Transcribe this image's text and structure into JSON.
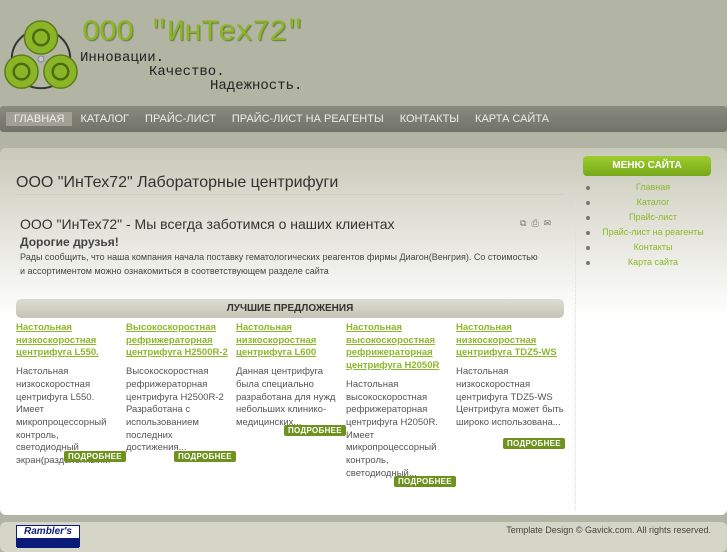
{
  "header": {
    "brand": "ООО \"ИнТех72\"",
    "slogan": [
      "Инновации.",
      "Качество.",
      "Надежность."
    ]
  },
  "nav": [
    "ГЛАВНАЯ",
    "КАТАЛОГ",
    "ПРАЙС-ЛИСТ",
    "ПРАЙС-ЛИСТ НА РЕАГЕНТЫ",
    "КОНТАКТЫ",
    "КАРТА САЙТА"
  ],
  "main": {
    "title": "ООО \"ИнТех72\" Лабораторные центрифуги",
    "article_title": "ООО \"ИнТех72\" - Мы всегда заботимся о наших клиентах",
    "greeting": "Дорогие друзья!",
    "intro": "Рады сообщить, что наша компания начала поставку гематологических реагентов фирмы Диагон(Венгрия). Со стоимостью и ассортиментом можно ознакомиться в соответствующем разделе сайта",
    "best_title": "ЛУЧШИЕ ПРЕДЛОЖЕНИЯ",
    "more_label": "ПОДРОБНЕЕ",
    "products": [
      {
        "title": "Настольная низкоскоростная центрифуга L550.",
        "desc": "Настольная низкоскоростная центрифуга L550. Имеет микропроцессорный контроль, светодиодный экран(разделенный..."
      },
      {
        "title": "Высокоскоростная рефрижераторная центрифуга H2500R-2",
        "desc": "Высокоскоростная рефрижераторная центрифуга H2500R-2 Разработана с использованием последних достижения..."
      },
      {
        "title": "Настольная низкоскоростная центрифуга L600",
        "desc": "Данная центрифуга была специально разработана для нужд небольших клинико-медицинских..."
      },
      {
        "title": "Настольная высокоскоростная рефрижераторная центрифуга H2050R",
        "desc": "Настольная высокоскоростная рефрижераторная центрифуга H2050R. Имеет микропроцессорный контроль, светодиодный..."
      },
      {
        "title": "Настольная низкоскоростная центрифуга TDZ5-WS",
        "desc": "Настольная низкоскоростная центрифуга TDZ5-WS Центрифуга может быть широко использована..."
      }
    ]
  },
  "sidebar": {
    "title": "МЕНЮ САЙТА",
    "items": [
      "Главная",
      "Каталог",
      "Прайс-лист",
      "Прайс-лист на реагенты",
      "Контакты",
      "Карта сайта"
    ]
  },
  "footer": {
    "counter": "Rambler's",
    "copyright": "Template Design © Gavick.com. All rights reserved."
  }
}
